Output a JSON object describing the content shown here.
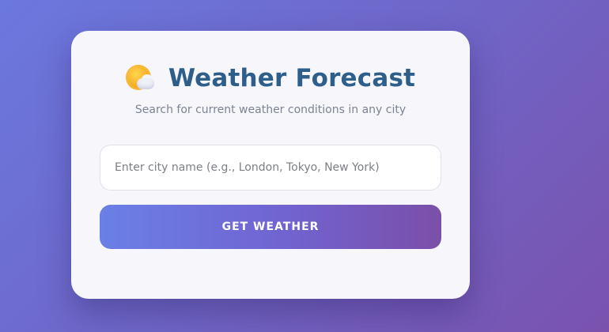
{
  "app": {
    "title": "Weather Forecast",
    "subtitle": "Search for current weather conditions in any city",
    "icon": "sun-behind-cloud-icon"
  },
  "search": {
    "value": "",
    "placeholder": "Enter city name (e.g., London, Tokyo, New York)"
  },
  "actions": {
    "get_weather_label": "GET WEATHER"
  },
  "colors": {
    "title": "#2e5f8a",
    "card_bg": "#f6f6fb",
    "button_start": "#6a80e6",
    "button_end": "#7b4fa8",
    "page_bg_start": "#6b78de",
    "page_bg_end": "#7a52ae"
  }
}
